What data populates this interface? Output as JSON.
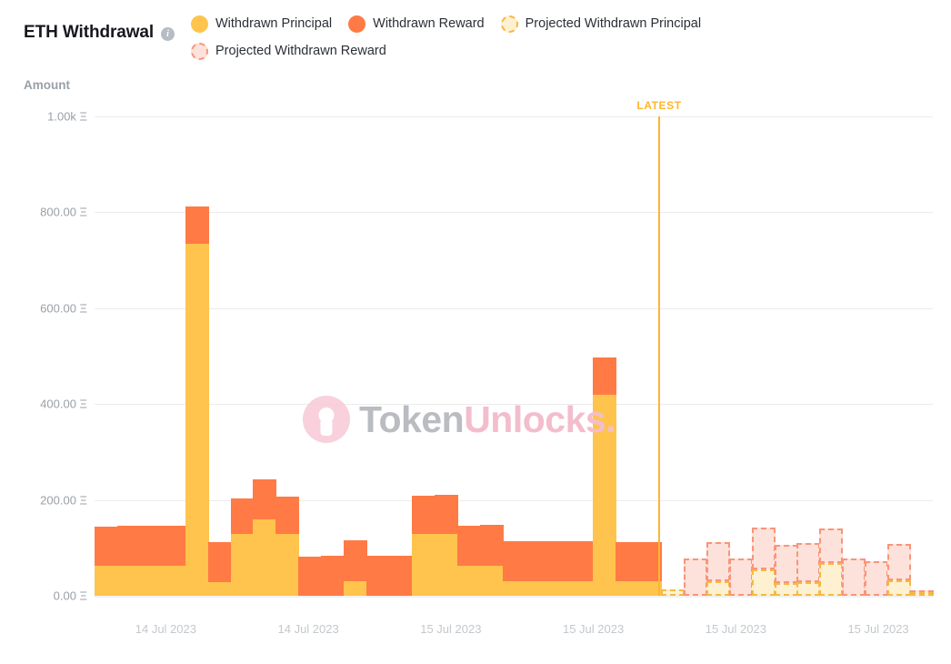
{
  "header": {
    "title": "ETH Withdrawal",
    "info_icon": "info-icon",
    "legend": [
      {
        "label": "Withdrawn Principal",
        "swatch": "solid-yellow",
        "color": "#FFC44D"
      },
      {
        "label": "Withdrawn Reward",
        "swatch": "solid-orange",
        "color": "#FF7A45"
      },
      {
        "label": "Projected Withdrawn Principal",
        "swatch": "dash-yellow",
        "color": "#FDF1D2"
      },
      {
        "label": "Projected Withdrawn Reward",
        "swatch": "dash-orange",
        "color": "#FCE2DA"
      }
    ]
  },
  "annotations": {
    "latest_label": "LATEST"
  },
  "watermark": {
    "text_primary": "Token",
    "text_secondary": "Unlocks."
  },
  "chart_data": {
    "type": "bar",
    "title": "ETH Withdrawal",
    "stacked": true,
    "xlabel": "",
    "ylabel": "Amount",
    "ylim": [
      0,
      1000
    ],
    "yticks": [
      0,
      200,
      400,
      600,
      800,
      1000
    ],
    "ytick_labels": [
      "0.00 Ξ",
      "200.00 Ξ",
      "400.00 Ξ",
      "600.00 Ξ",
      "800.00 Ξ",
      "1.00k Ξ"
    ],
    "grid": true,
    "legend_position": "top",
    "xtick_labels": [
      "14 Jul 2023",
      "14 Jul 2023",
      "15 Jul 2023",
      "15 Jul 2023",
      "15 Jul 2023",
      "15 Jul 2023"
    ],
    "xtick_positions": [
      0.085,
      0.255,
      0.425,
      0.595,
      0.765,
      0.935
    ],
    "latest_index": 18,
    "series": [
      {
        "name": "Withdrawn Principal",
        "values": [
          62,
          62,
          62,
          62,
          735,
          28,
          130,
          160,
          130,
          0,
          0,
          30,
          0,
          0,
          130,
          130,
          62,
          62,
          30,
          30,
          30,
          30,
          420,
          30,
          30,
          null,
          null,
          null,
          null,
          null,
          null,
          null,
          null,
          null,
          null,
          null,
          null
        ]
      },
      {
        "name": "Withdrawn Reward",
        "values": [
          82,
          85,
          84,
          85,
          78,
          84,
          74,
          82,
          76,
          82,
          84,
          85,
          84,
          84,
          78,
          80,
          85,
          86,
          84,
          84,
          84,
          84,
          78,
          82,
          82,
          null,
          null,
          null,
          null,
          null,
          null,
          null,
          null,
          null,
          null,
          null,
          null
        ]
      },
      {
        "name": "Projected Withdrawn Principal",
        "values": [
          null,
          null,
          null,
          null,
          null,
          null,
          null,
          null,
          null,
          null,
          null,
          null,
          null,
          null,
          null,
          null,
          null,
          null,
          null,
          null,
          null,
          null,
          null,
          null,
          null,
          14,
          0,
          30,
          0,
          55,
          26,
          28,
          68,
          0,
          0,
          32,
          4
        ]
      },
      {
        "name": "Projected Withdrawn Reward",
        "values": [
          null,
          null,
          null,
          null,
          null,
          null,
          null,
          null,
          null,
          null,
          null,
          null,
          null,
          null,
          null,
          null,
          null,
          null,
          null,
          null,
          null,
          null,
          null,
          null,
          null,
          0,
          78,
          82,
          78,
          88,
          80,
          82,
          72,
          78,
          72,
          76,
          4
        ]
      }
    ],
    "bars_total": [
      144,
      147,
      146,
      147,
      813,
      112,
      204,
      242,
      206,
      82,
      84,
      115,
      84,
      84,
      208,
      210,
      147,
      148,
      114,
      114,
      114,
      114,
      498,
      112,
      112,
      14,
      78,
      112,
      78,
      143,
      106,
      110,
      140,
      78,
      72,
      108,
      8
    ]
  }
}
